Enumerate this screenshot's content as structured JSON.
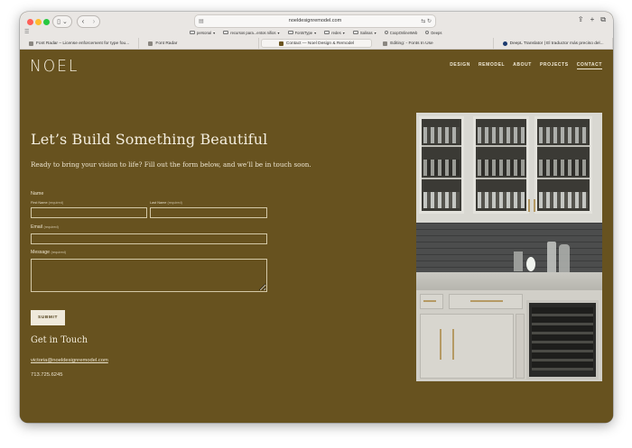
{
  "browser": {
    "url": "noeldesignremodel.com",
    "bookmarks": [
      "personal",
      "recursos para...entos nifios",
      "FontsType",
      "redes",
      "Salinas",
      "CoopOnlineWeb",
      "Deeps"
    ],
    "tabs": [
      {
        "label": "Font Radar – License enforcement for type fou..."
      },
      {
        "label": "Font Radar"
      },
      {
        "label": "Contact — Noel Design & Remodel",
        "active": true
      },
      {
        "label": "Editing: - Fonts In Use"
      },
      {
        "label": "DeepL Translator | El traductor más preciso del..."
      }
    ]
  },
  "site": {
    "logo": "NOEL",
    "nav": [
      "DESIGN",
      "REMODEL",
      "ABOUT",
      "PROJECTS",
      "CONTACT"
    ],
    "active_nav": "CONTACT"
  },
  "content": {
    "heading": "Let’s Build Something Beautiful",
    "intro": "Ready to bring your vision to life? Fill out the form below, and we’ll be in touch soon.",
    "form": {
      "name_label": "Name",
      "first_name_label": "First Name",
      "last_name_label": "Last Name",
      "required_tag": "(required)",
      "email_label": "Email",
      "message_label": "Message",
      "submit_label": "SUBMIT"
    },
    "contact": {
      "heading": "Get in Touch",
      "email": "victoria@noeldesignremodel.com",
      "phone": "713.725.6245"
    }
  },
  "colors": {
    "page_bg": "#67521f",
    "text": "#efe8d6",
    "submit_bg": "#efe9db"
  }
}
